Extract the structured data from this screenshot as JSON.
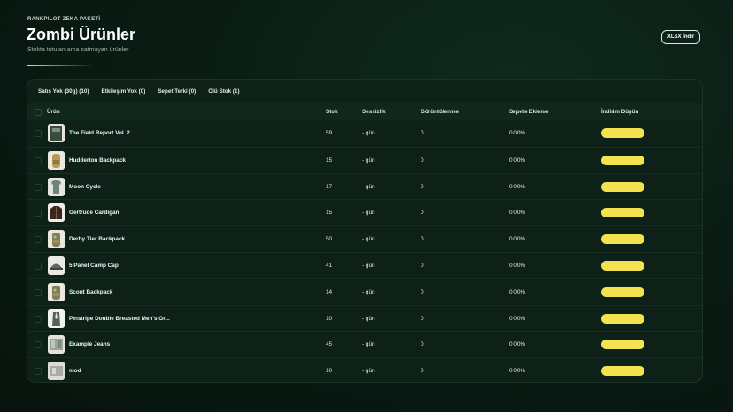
{
  "header": {
    "eyebrow": "RANKPILOT ZEKA PAKETİ",
    "title": "Zombi Ürünler",
    "subtitle": "Stokta tutulan ama satmayan ürünler",
    "export_label": "XLSX İndir"
  },
  "tabs": [
    {
      "label": "Satış Yok (30g) (10)"
    },
    {
      "label": "Etkileşim Yok (0)"
    },
    {
      "label": "Sepet Terki (0)"
    },
    {
      "label": "Ölü Stok (1)"
    }
  ],
  "table": {
    "columns": {
      "product": "Ürün",
      "stock": "Stok",
      "silence": "Sessizlik",
      "views": "Görüntülenme",
      "cart_add": "Sepete Ekleme",
      "discount": "İndirim Düşün"
    },
    "rows": [
      {
        "name": "The Field Report Vol. 2",
        "stock": "59",
        "silence": "- gün",
        "views": "0",
        "cart_add": "0,00%",
        "thumb": "book",
        "action": ""
      },
      {
        "name": "Hudderton Backpack",
        "stock": "15",
        "silence": "- gün",
        "views": "0",
        "cart_add": "0,00%",
        "thumb": "backpack",
        "action": ""
      },
      {
        "name": "Moon Cycle",
        "stock": "17",
        "silence": "- gün",
        "views": "0",
        "cart_add": "0,00%",
        "thumb": "shirt",
        "action": ""
      },
      {
        "name": "Gertrude Cardigan",
        "stock": "15",
        "silence": "- gün",
        "views": "0",
        "cart_add": "0,00%",
        "thumb": "cardigan",
        "action": ""
      },
      {
        "name": "Derby Tier Backpack",
        "stock": "50",
        "silence": "- gün",
        "views": "0",
        "cart_add": "0,00%",
        "thumb": "backpack-camo",
        "action": ""
      },
      {
        "name": "5 Panel Camp Cap",
        "stock": "41",
        "silence": "- gün",
        "views": "0",
        "cart_add": "0,00%",
        "thumb": "cap",
        "action": ""
      },
      {
        "name": "Scout Backpack",
        "stock": "14",
        "silence": "- gün",
        "views": "0",
        "cart_add": "0,00%",
        "thumb": "backpack-camo",
        "action": ""
      },
      {
        "name": "Pinstripe Double Breasted Men's Gr...",
        "stock": "10",
        "silence": "- gün",
        "views": "0",
        "cart_add": "0,00%",
        "thumb": "suit",
        "action": ""
      },
      {
        "name": "Example Jeans",
        "stock": "45",
        "silence": "- gün",
        "views": "0",
        "cart_add": "0,00%",
        "thumb": "jeans",
        "action": ""
      },
      {
        "name": "mod",
        "stock": "10",
        "silence": "- gün",
        "views": "0",
        "cart_add": "0,00%",
        "thumb": "mod",
        "action": ""
      }
    ]
  },
  "colors": {
    "background": "#0a1c14",
    "panel": "#0d2118",
    "header_row": "#10271c",
    "action_pill": "#f2e34f"
  }
}
